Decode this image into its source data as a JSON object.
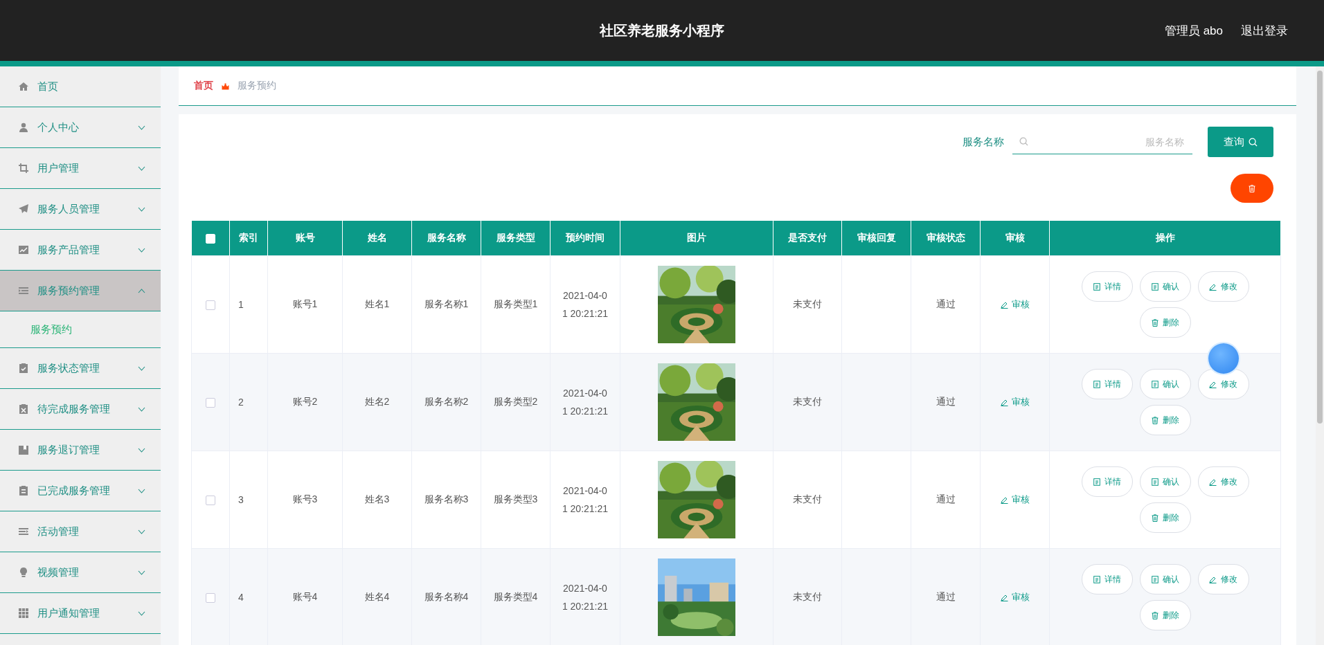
{
  "header": {
    "title": "社区养老服务小程序",
    "user": "管理员 abo",
    "logout": "退出登录"
  },
  "sidebar": {
    "items": [
      {
        "label": "首页"
      },
      {
        "label": "个人中心",
        "expanded": false
      },
      {
        "label": "用户管理",
        "expanded": false
      },
      {
        "label": "服务人员管理",
        "expanded": false
      },
      {
        "label": "服务产品管理",
        "expanded": false
      },
      {
        "label": "服务预约管理",
        "expanded": true,
        "children": [
          {
            "label": "服务预约",
            "selected": true
          }
        ]
      },
      {
        "label": "服务状态管理",
        "expanded": false
      },
      {
        "label": "待完成服务管理",
        "expanded": false
      },
      {
        "label": "服务退订管理",
        "expanded": false
      },
      {
        "label": "已完成服务管理",
        "expanded": false
      },
      {
        "label": "活动管理",
        "expanded": false
      },
      {
        "label": "视频管理",
        "expanded": false
      },
      {
        "label": "用户通知管理",
        "expanded": false
      }
    ]
  },
  "breadcrumb": [
    "首页",
    "服务预约"
  ],
  "search": {
    "label": "服务名称",
    "placeholder": "服务名称",
    "button": "查询"
  },
  "table": {
    "header_checkbox": {
      "checked": false
    },
    "columns": [
      "索引",
      "账号",
      "姓名",
      "服务名称",
      "服务类型",
      "预约时间",
      "图片",
      "是否支付",
      "审核回复",
      "审核状态",
      "审核",
      "操作"
    ],
    "rows": [
      {
        "checked": false,
        "index": "1",
        "account": "账号1",
        "name": "姓名1",
        "service_name": "服务名称1",
        "service_type": "服务类型1",
        "time": "2021-04-01 20:21:21",
        "paid": "未支付",
        "status": "通过",
        "review": "审核",
        "actions": [
          "详情",
          "确认",
          "修改",
          "删除"
        ]
      },
      {
        "checked": false,
        "index": "2",
        "account": "账号2",
        "name": "姓名2",
        "service_name": "服务名称2",
        "service_type": "服务类型2",
        "time": "2021-04-01 20:21:21",
        "paid": "未支付",
        "status": "通过",
        "review": "审核",
        "actions": [
          "详情",
          "确认",
          "修改",
          "删除"
        ]
      },
      {
        "checked": false,
        "index": "3",
        "account": "账号3",
        "name": "姓名3",
        "service_name": "服务名称3",
        "service_type": "服务类型3",
        "time": "2021-04-01 20:21:21",
        "paid": "未支付",
        "status": "通过",
        "review": "审核",
        "actions": [
          "详情",
          "确认",
          "修改",
          "删除"
        ]
      },
      {
        "checked": false,
        "index": "4",
        "account": "账号4",
        "name": "姓名4",
        "service_name": "服务名称4",
        "service_type": "服务类型4",
        "time": "2021-04-01 20:21:21",
        "paid": "未支付",
        "status": "通过",
        "review": "审核",
        "actions": [
          "详情",
          "确认",
          "修改",
          "删除"
        ]
      }
    ]
  }
}
